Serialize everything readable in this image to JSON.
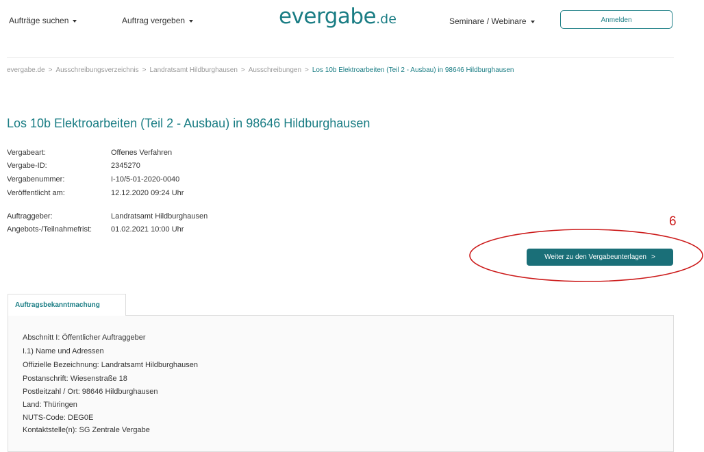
{
  "header": {
    "nav_left": [
      {
        "label": "Aufträge suchen"
      },
      {
        "label": "Auftrag vergeben"
      }
    ],
    "logo": {
      "brand": "evergabe",
      "tld": ".de"
    },
    "nav_right": {
      "label": "Seminare / Webinare"
    },
    "login_label": "Anmelden"
  },
  "breadcrumb": {
    "items": [
      "evergabe.de",
      "Ausschreibungsverzeichnis",
      "Landratsamt Hildburghausen",
      "Ausschreibungen"
    ],
    "current": "Los 10b Elektroarbeiten (Teil 2 - Ausbau) in 98646 Hildburghausen",
    "separator": ">"
  },
  "title": "Los 10b Elektroarbeiten (Teil 2 - Ausbau) in 98646 Hildburghausen",
  "details": [
    {
      "label": "Vergabeart:",
      "value": "Offenes Verfahren"
    },
    {
      "label": "Vergabe-ID:",
      "value": "2345270"
    },
    {
      "label": "Vergabenummer:",
      "value": "I-10/5-01-2020-0040"
    },
    {
      "label": "Veröffentlicht am:",
      "value": "12.12.2020 09:24 Uhr"
    },
    {
      "label": "Auftraggeber:",
      "value": "Landratsamt Hildburghausen"
    },
    {
      "label": "Angebots-/Teilnahmefrist:",
      "value": "01.02.2021 10:00 Uhr"
    }
  ],
  "action_button": {
    "label": "Weiter zu den Vergabeunterlagen",
    "chevron": ">"
  },
  "annotation": {
    "number": "6",
    "color": "#cc1a1a"
  },
  "tab": {
    "label": "Auftragsbekanntmachung"
  },
  "notice_lines": [
    "Abschnitt I: Öffentlicher Auftraggeber",
    "I.1) Name und Adressen",
    "Offizielle Bezeichnung: Landratsamt Hildburghausen",
    "Postanschrift: Wiesenstraße 18",
    "Postleitzahl / Ort: 98646 Hildburghausen",
    "Land: Thüringen",
    "NUTS-Code: DEG0E",
    "Kontaktstelle(n): SG Zentrale Vergabe"
  ],
  "colors": {
    "brand": "#1a7d84",
    "button": "#1a6f78",
    "annotation": "#cc1a1a"
  }
}
